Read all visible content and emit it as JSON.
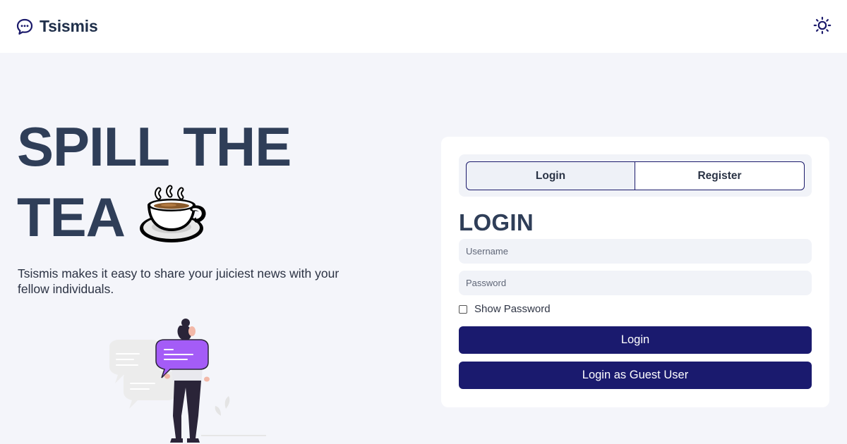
{
  "app": {
    "name": "Tsismis"
  },
  "nav": {
    "brand_icon": "chat-bubble-icon",
    "theme_icon": "sun-icon"
  },
  "hero": {
    "title_line1": "SPILL THE",
    "title_line2": "TEA",
    "tea_icon": "hot-beverage-emoji",
    "description": "Tsismis makes it easy to share your juiciest news with your fellow individuals."
  },
  "auth": {
    "tabs": [
      {
        "label": "Login",
        "active": true
      },
      {
        "label": "Register",
        "active": false
      }
    ],
    "heading": "LOGIN",
    "username_placeholder": "Username",
    "password_placeholder": "Password",
    "show_password_label": "Show Password",
    "login_button": "Login",
    "guest_button": "Login as Guest User"
  },
  "colors": {
    "primary": "#1a1a6e",
    "heading": "#2f3e58",
    "background": "#f4f5fa",
    "accent_purple": "#a45cf7"
  }
}
